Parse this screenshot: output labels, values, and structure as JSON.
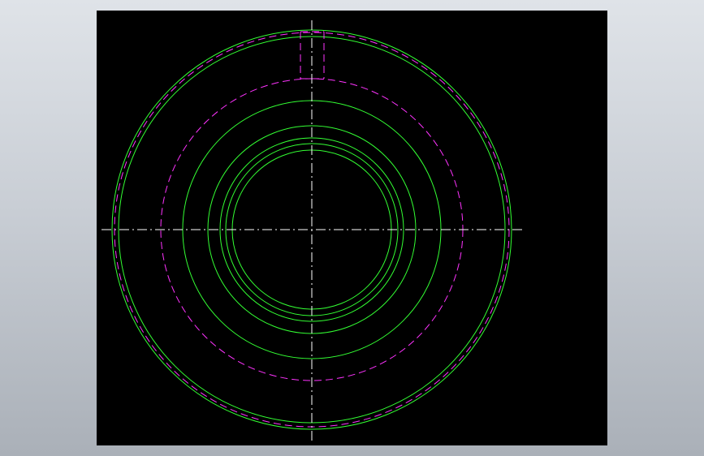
{
  "viewport": {
    "background": "#000000"
  },
  "colors": {
    "solid_lines": "#33ff33",
    "hidden_lines": "#ff33ff",
    "centerlines": "#ffffff",
    "background_gradient_top": "#dfe3e8",
    "background_gradient_bottom": "#aab0b8"
  },
  "drawing": {
    "type": "cad-front-view",
    "visible_circles": 7,
    "hidden_circles": 2,
    "keyway_slot": true,
    "centerlines": [
      "horizontal",
      "vertical"
    ]
  }
}
